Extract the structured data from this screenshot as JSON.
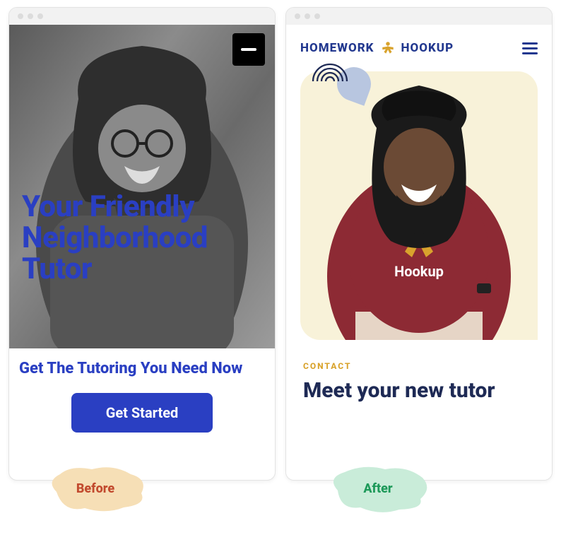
{
  "before": {
    "hero_title": "Your Friendly Neighborhood Tutor",
    "subheading": "Get The Tutoring You Need Now",
    "cta": "Get Started",
    "label": "Before"
  },
  "after": {
    "brand_left": "HOMEWORK",
    "brand_right": "HOOKUP",
    "eyebrow": "CONTACT",
    "title": "Meet your new tutor",
    "shirt_line": "Hookup",
    "label": "After"
  }
}
